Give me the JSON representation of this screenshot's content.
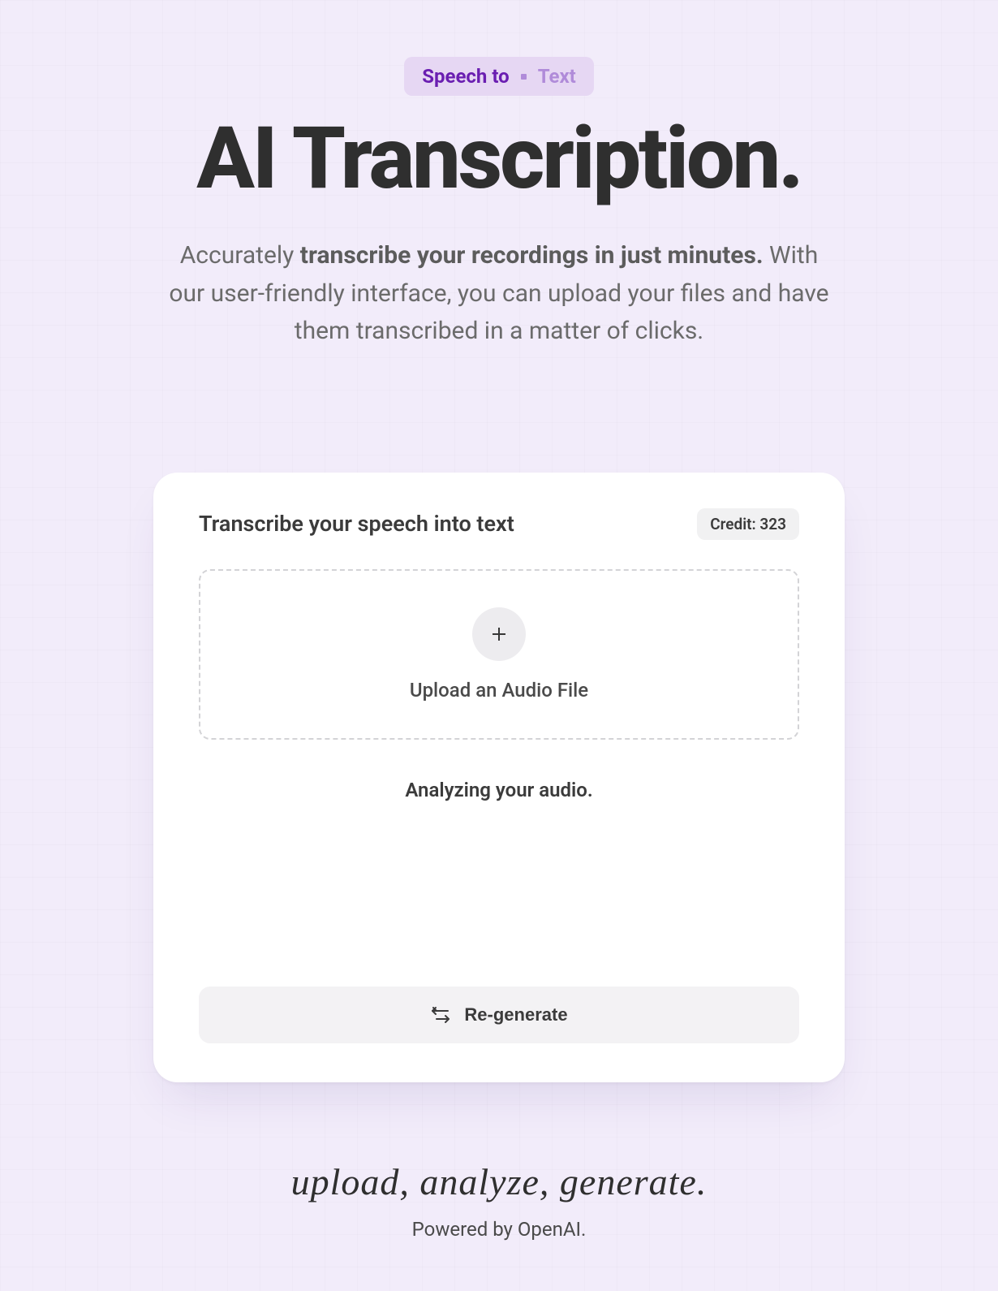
{
  "pill": {
    "left": "Speech to",
    "right": "Text"
  },
  "headline": "AI Transcription.",
  "subcopy": {
    "pre": "Accurately ",
    "bold": "transcribe your recordings in just minutes.",
    "post": " With our user-friendly interface, you can upload your files and have them transcribed in a matter of clicks."
  },
  "card": {
    "title": "Transcribe your speech into text",
    "credit_label": "Credit: 323",
    "upload_label": "Upload an Audio File",
    "status_text": "Analyzing your audio.",
    "regenerate_label": "Re-generate"
  },
  "footer": {
    "tagline": "upload, analyze, generate.",
    "powered": "Powered by OpenAI."
  }
}
